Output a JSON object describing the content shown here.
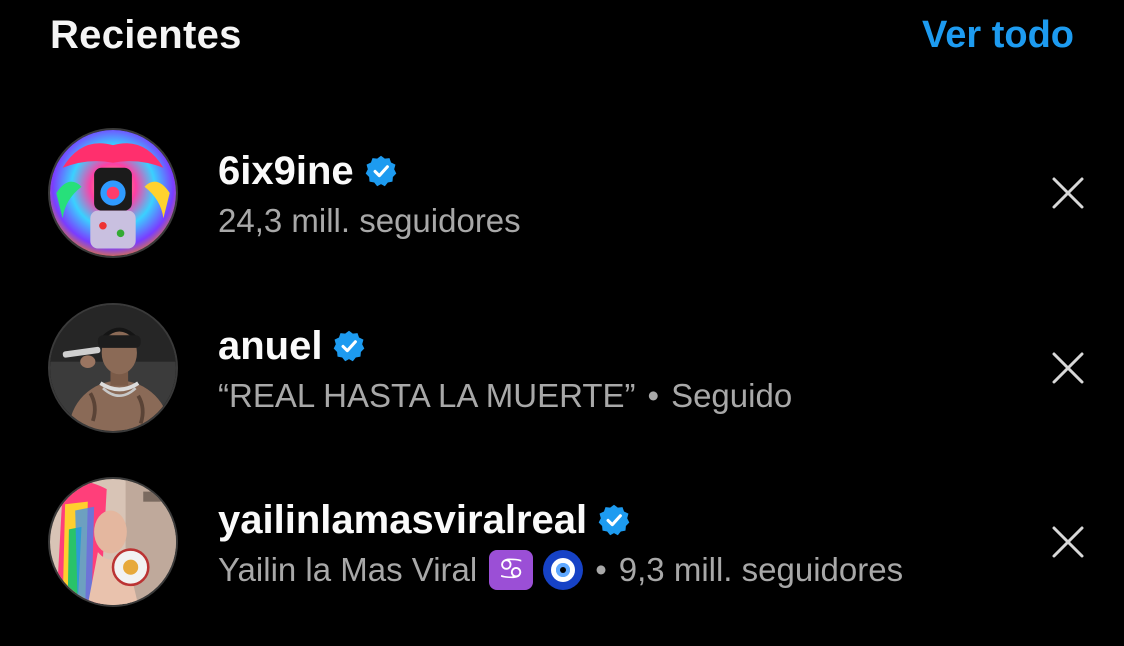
{
  "header": {
    "title": "Recientes",
    "see_all": "Ver todo"
  },
  "colors": {
    "background": "#000000",
    "link": "#1d9bf0",
    "verified": "#1d9bf0",
    "secondary_text": "#a8a8a8"
  },
  "recents": [
    {
      "username": "6ix9ine",
      "verified": true,
      "subtitle": "24,3 mill. seguidores",
      "avatar_icon": "rainbow-hair-artist-avatar",
      "remove_icon": "close-icon"
    },
    {
      "username": "anuel",
      "verified": true,
      "bio": "“REAL HASTA LA MUERTE”",
      "separator": "•",
      "status": "Seguido",
      "avatar_icon": "singer-with-microphone-avatar",
      "remove_icon": "close-icon"
    },
    {
      "username": "yailinlamasviralreal",
      "verified": true,
      "display_name": "Yailin la Mas Viral",
      "emojis": [
        "cancer-zodiac-emoji",
        "nazar-amulet-emoji"
      ],
      "emoji_symbol": "♋",
      "separator": "•",
      "followers": "9,3 mill. seguidores",
      "avatar_icon": "rainbow-hair-woman-avatar",
      "remove_icon": "close-icon"
    }
  ]
}
